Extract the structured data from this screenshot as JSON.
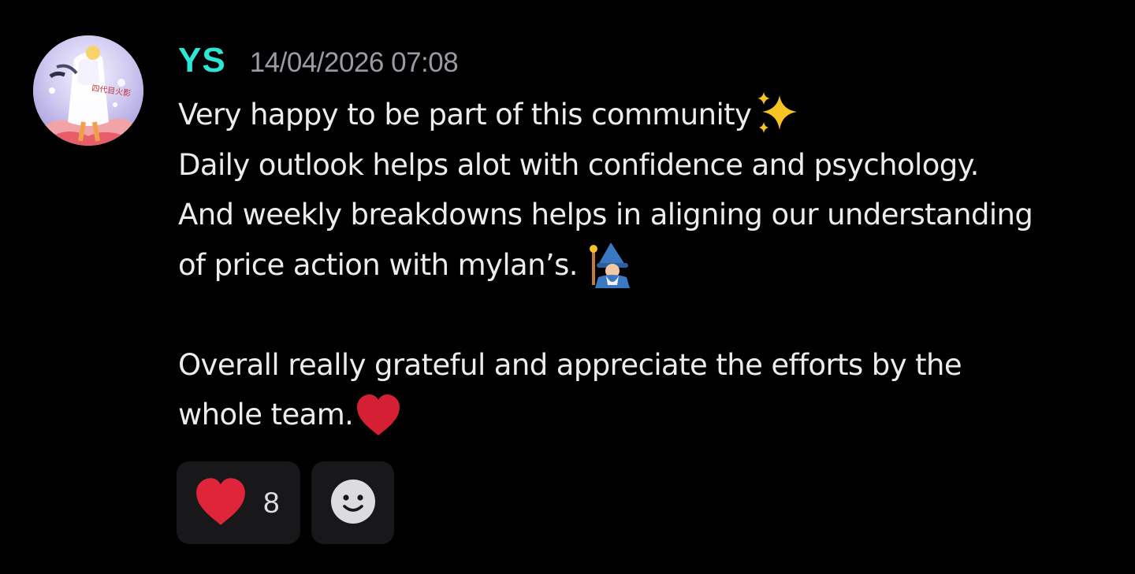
{
  "message": {
    "author": "YS",
    "timestamp": "14/04/2026 07:08",
    "username_color": "#2ee6d6",
    "lines": [
      "Very happy to be part of this community",
      "Daily outlook helps alot with confidence and psychology.",
      "And weekly breakdowns helps in aligning our understanding",
      "of price action with mylan’s.",
      "",
      "Overall really grateful and appreciate the efforts by the",
      "whole team."
    ],
    "emojis": {
      "line1": "sparkles-emoji",
      "line4": "mage-emoji",
      "line7": "red-heart-emoji"
    }
  },
  "reactions": [
    {
      "icon": "red-heart-emoji",
      "count": "8"
    },
    {
      "icon": "add-reaction-smiley-icon"
    }
  ],
  "colors": {
    "background": "#000000",
    "text": "#ececef",
    "timestamp": "#9a9ba3",
    "reaction_bg": "#18181b",
    "heart": "#e0243a"
  }
}
